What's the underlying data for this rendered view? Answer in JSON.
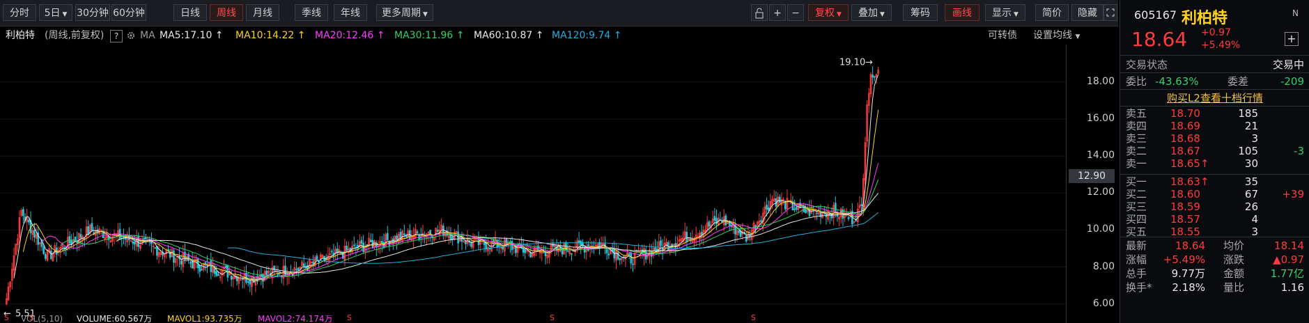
{
  "toolbar": {
    "periods": [
      {
        "label": "分时",
        "active": false
      },
      {
        "label": "5日",
        "active": false,
        "dropdown": true
      },
      {
        "label": "30分钟",
        "active": false
      },
      {
        "label": "60分钟",
        "active": false
      },
      {
        "label": "日线",
        "active": false
      },
      {
        "label": "周线",
        "active": true
      },
      {
        "label": "月线",
        "active": false
      },
      {
        "label": "季线",
        "active": false
      },
      {
        "label": "年线",
        "active": false
      },
      {
        "label": "更多周期",
        "active": false,
        "dropdown": true
      }
    ],
    "right_buttons": [
      {
        "label": "复权",
        "active": true,
        "dropdown": true
      },
      {
        "label": "叠加",
        "active": false,
        "dropdown": true
      },
      {
        "label": "筹码",
        "active": false
      },
      {
        "label": "画线",
        "active": true
      },
      {
        "label": "显示",
        "active": false,
        "dropdown": true
      },
      {
        "label": "简价",
        "active": false
      },
      {
        "label": "隐藏",
        "active": false
      }
    ],
    "zoom_in": "+",
    "zoom_out": "−"
  },
  "indicators": {
    "stock_name": "利柏特",
    "mode": "(周线,前复权)",
    "help": "?",
    "ma_label": "MA",
    "ma5": "MA5:17.10",
    "ma10": "MA10:14.22",
    "ma20": "MA20:12.46",
    "ma30": "MA30:11.96",
    "ma60": "MA60:10.87",
    "ma120": "MA120:9.74",
    "convertible": "可转债",
    "set_ma": "设置均线"
  },
  "chart_data": {
    "type": "candlestick",
    "ylim": [
      5.5,
      19.5
    ],
    "yticks": [
      "18.00",
      "16.00",
      "14.00",
      "12.00",
      "10.00",
      "8.00",
      "6.00"
    ],
    "current_price_label": "12.90",
    "max_label": "19.10",
    "min_label": "5.51",
    "colors": {
      "up": "#ff3b3b",
      "down": "#23c4d8",
      "ma5": "#e8e8e8",
      "ma10": "#ffd21e",
      "ma20": "#ff3bff",
      "ma30": "#2fd26b",
      "ma60": "#e8e8e8",
      "ma120": "#23aee0"
    }
  },
  "bottom_strip": {
    "vol": "VOL(5,10)",
    "volume": "VOLUME:60.567万",
    "mavol1": "MAVOL1:93.735万",
    "mavol2": "MAVOL2:74.174万"
  },
  "panel": {
    "code": "605167",
    "name": "利柏特",
    "badge": "N",
    "price": "18.64",
    "change": "+0.97",
    "change_pct": "+5.49%",
    "add": "+",
    "status_label": "交易状态",
    "status_value": "交易中",
    "weibi_label": "委比",
    "weibi_value": "-43.63%",
    "weicha_label": "委差",
    "weicha_value": "-209",
    "l2_link": "购买L2查看十档行情",
    "asks": [
      {
        "label": "卖五",
        "price": "18.70",
        "vol": "185",
        "delta": ""
      },
      {
        "label": "卖四",
        "price": "18.69",
        "vol": "21",
        "delta": ""
      },
      {
        "label": "卖三",
        "price": "18.68",
        "vol": "3",
        "delta": ""
      },
      {
        "label": "卖二",
        "price": "18.67",
        "vol": "105",
        "delta": "-3"
      },
      {
        "label": "卖一",
        "price": "18.65↑",
        "vol": "30",
        "delta": ""
      }
    ],
    "bids": [
      {
        "label": "买一",
        "price": "18.63↑",
        "vol": "35",
        "delta": ""
      },
      {
        "label": "买二",
        "price": "18.60",
        "vol": "67",
        "delta": "+39"
      },
      {
        "label": "买三",
        "price": "18.59",
        "vol": "26",
        "delta": ""
      },
      {
        "label": "买四",
        "price": "18.57",
        "vol": "4",
        "delta": ""
      },
      {
        "label": "买五",
        "price": "18.55",
        "vol": "3",
        "delta": ""
      }
    ],
    "stats": [
      {
        "l1": "最新",
        "v1": "18.64",
        "l2": "均价",
        "v2": "18.14"
      },
      {
        "l1": "涨幅",
        "v1": "+5.49%",
        "l2": "涨跌",
        "v2": "▲0.97"
      },
      {
        "l1": "总手",
        "v1": "9.77万",
        "l2": "金额",
        "v2": "1.77亿"
      },
      {
        "l1": "换手*",
        "v1": "2.18%",
        "l2": "量比",
        "v2": "1.16"
      }
    ]
  }
}
